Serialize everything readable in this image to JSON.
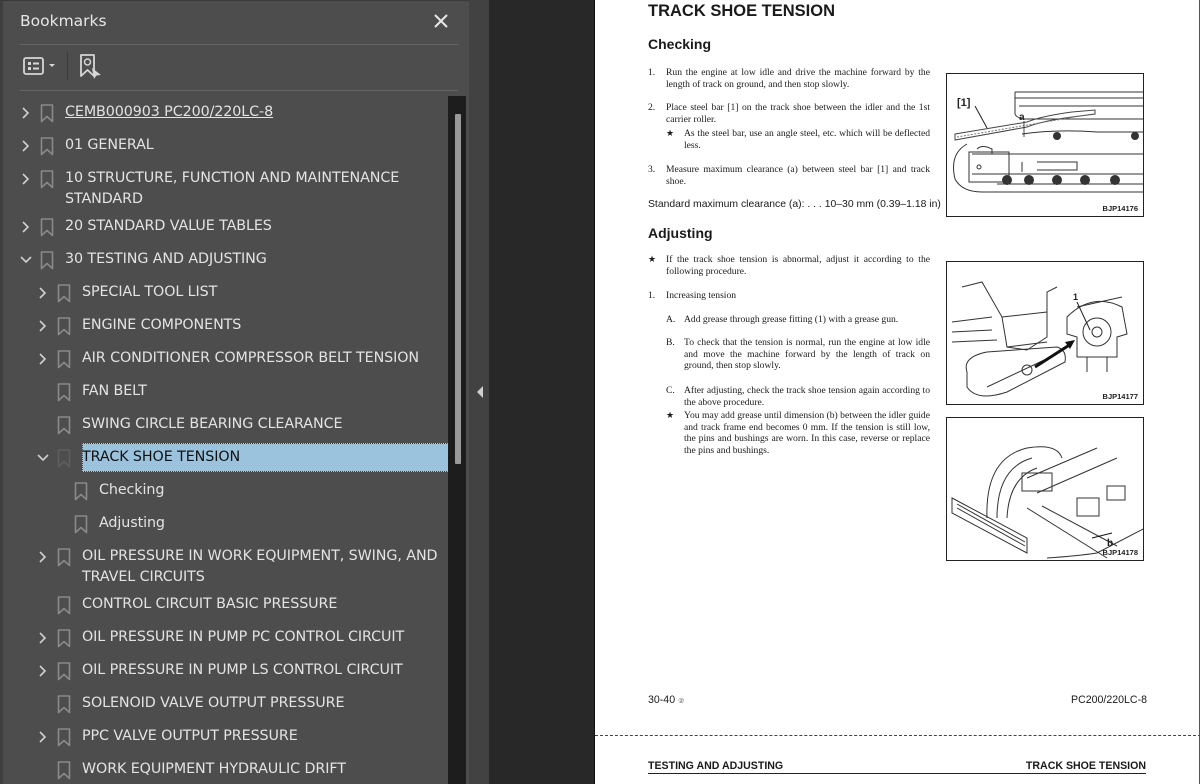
{
  "panel": {
    "title": "Bookmarks",
    "close_icon": "close-icon",
    "toolbar": {
      "options_icon": "list-options-icon",
      "find_icon": "find-current-bookmark-icon"
    }
  },
  "bookmarks": [
    {
      "label": "CEMB000903 PC200/220LC-8",
      "level": 0,
      "expander": "collapsed",
      "link": true
    },
    {
      "label": "01 GENERAL",
      "level": 0,
      "expander": "collapsed"
    },
    {
      "label": "10 STRUCTURE, FUNCTION AND MAINTENANCE\nSTANDARD",
      "level": 0,
      "expander": "collapsed"
    },
    {
      "label": "20 STANDARD VALUE TABLES",
      "level": 0,
      "expander": "collapsed"
    },
    {
      "label": "30 TESTING AND ADJUSTING",
      "level": 0,
      "expander": "expanded"
    },
    {
      "label": "SPECIAL TOOL LIST",
      "level": 1,
      "expander": "collapsed"
    },
    {
      "label": "ENGINE COMPONENTS",
      "level": 1,
      "expander": "collapsed"
    },
    {
      "label": "AIR CONDITIONER COMPRESSOR BELT TENSION",
      "level": 1,
      "expander": "collapsed"
    },
    {
      "label": "FAN BELT",
      "level": 1,
      "expander": "none"
    },
    {
      "label": "SWING CIRCLE BEARING CLEARANCE",
      "level": 1,
      "expander": "none"
    },
    {
      "label": "TRACK SHOE TENSION",
      "level": 1,
      "expander": "expanded",
      "selected": true
    },
    {
      "label": "Checking",
      "level": 2,
      "expander": "none"
    },
    {
      "label": "Adjusting",
      "level": 2,
      "expander": "none"
    },
    {
      "label": "OIL PRESSURE IN WORK EQUIPMENT, SWING, AND\nTRAVEL CIRCUITS",
      "level": 1,
      "expander": "collapsed"
    },
    {
      "label": "CONTROL CIRCUIT BASIC PRESSURE",
      "level": 1,
      "expander": "none"
    },
    {
      "label": "OIL PRESSURE IN PUMP PC CONTROL CIRCUIT",
      "level": 1,
      "expander": "collapsed"
    },
    {
      "label": "OIL PRESSURE IN PUMP LS CONTROL CIRCUIT",
      "level": 1,
      "expander": "collapsed"
    },
    {
      "label": "SOLENOID VALVE OUTPUT PRESSURE",
      "level": 1,
      "expander": "none"
    },
    {
      "label": "PPC VALVE OUTPUT PRESSURE",
      "level": 1,
      "expander": "collapsed"
    },
    {
      "label": "WORK EQUIPMENT HYDRAULIC DRIFT",
      "level": 1,
      "expander": "none"
    }
  ],
  "colors": {
    "panel_bg": "#4d4d4d",
    "selection_bg": "#9cc3dd",
    "viewer_bg": "#282828"
  },
  "document": {
    "title": "TRACK SHOE TENSION",
    "checking": {
      "heading": "Checking",
      "steps": [
        {
          "num": "1.",
          "text": "Run the engine at low idle and drive the machine forward by the length of track on ground, and then stop slowly."
        },
        {
          "num": "2.",
          "text": "Place steel bar [1] on the track shoe between the idler and the 1st carrier roller."
        },
        {
          "num": "★",
          "text": "As the steel bar, use an angle steel, etc. which will be deflected less."
        },
        {
          "num": "3.",
          "text": "Measure maximum clearance (a) between steel bar [1] and track shoe."
        }
      ],
      "standard": "Standard maximum clearance (a): . . . 10–30 mm (0.39–1.18 in)"
    },
    "adjusting": {
      "heading": "Adjusting",
      "note": {
        "num": "★",
        "text": "If the track shoe tension is abnormal, adjust it according to the following procedure."
      },
      "step1": {
        "num": "1.",
        "text": "Increasing tension"
      },
      "substeps": [
        {
          "num": "A.",
          "text": "Add grease through grease fitting (1) with a grease gun."
        },
        {
          "num": "B.",
          "text": "To check that the tension is normal, run the engine at low idle and move the machine forward by the length of track on ground, then stop slowly."
        },
        {
          "num": "C.",
          "text": "After adjusting, check the track shoe tension again according to the above procedure."
        },
        {
          "num": "★",
          "text": "You may add grease until dimension (b) between the idler guide and track frame end becomes 0 mm. If the tension is still low, the pins and bushings are worn. In this case, reverse or replace the pins and bushings."
        }
      ]
    },
    "figures": [
      {
        "caption": "BJP14176",
        "labels": [
          "[1]",
          "a"
        ]
      },
      {
        "caption": "BJP14177",
        "labels": [
          "1"
        ]
      },
      {
        "caption": "BJP14178",
        "labels": [
          "b"
        ]
      }
    ],
    "footer": {
      "page": "30-40",
      "revision_mark": "②",
      "model": "PC200/220LC-8"
    },
    "next_page_header": {
      "left": "TESTING AND ADJUSTING",
      "right": "TRACK SHOE TENSION"
    }
  }
}
